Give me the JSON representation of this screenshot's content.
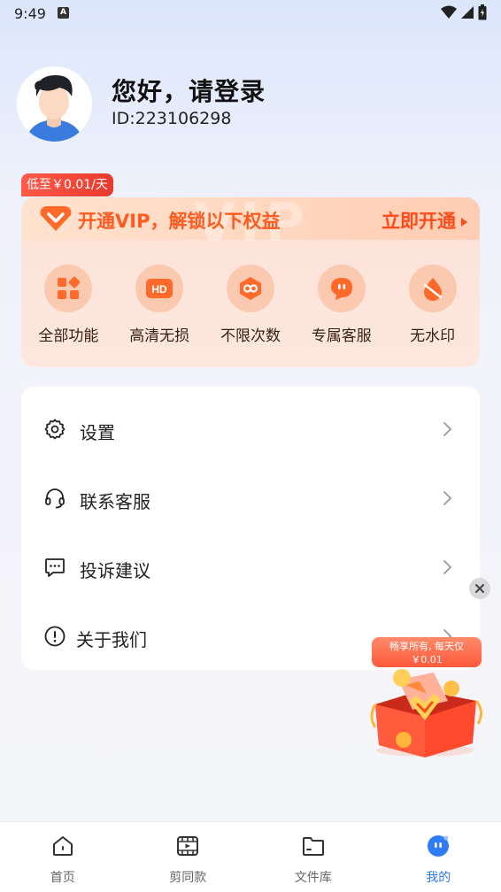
{
  "status_bar": {
    "time": "9:49",
    "indicator": "A",
    "icons": [
      "wifi-icon",
      "signal-icon",
      "battery-icon"
    ]
  },
  "profile": {
    "greeting": "您好，请登录",
    "user_id": "ID:223106298"
  },
  "vip": {
    "badge": "低至￥0.01/天",
    "title": "开通VIP，解锁以下权益",
    "open_label": "立即开通",
    "watermark": "VIP",
    "benefits": [
      {
        "label": "全部功能",
        "icon": "grid-icon"
      },
      {
        "label": "高清无损",
        "icon": "hd-icon"
      },
      {
        "label": "不限次数",
        "icon": "infinity-icon"
      },
      {
        "label": "专属客服",
        "icon": "chat-bubble-icon"
      },
      {
        "label": "无水印",
        "icon": "no-watermark-icon"
      }
    ],
    "accent": "#ff5a1f"
  },
  "menu": [
    {
      "label": "设置",
      "icon": "gear-icon"
    },
    {
      "label": "联系客服",
      "icon": "headset-icon"
    },
    {
      "label": "投诉建议",
      "icon": "message-icon"
    },
    {
      "label": "关于我们",
      "icon": "info-icon"
    }
  ],
  "promo": {
    "line1": "畅享所有, 每天仅",
    "line2": "￥0.01"
  },
  "tabs": [
    {
      "label": "首页",
      "icon": "home-icon"
    },
    {
      "label": "剪同款",
      "icon": "video-template-icon"
    },
    {
      "label": "文件库",
      "icon": "folder-icon"
    },
    {
      "label": "我的",
      "icon": "profile-icon"
    }
  ],
  "active_tab_color": "#2f7cf6"
}
